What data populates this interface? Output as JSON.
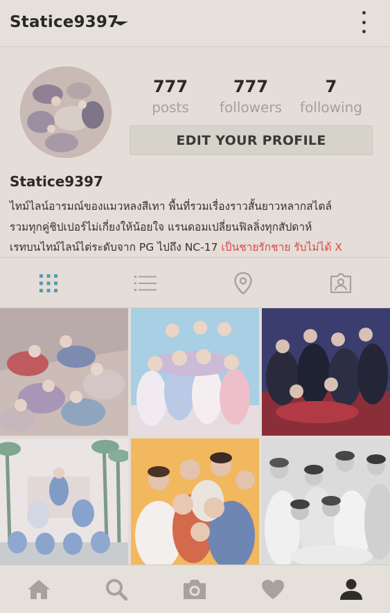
{
  "header": {
    "username": "Statice9397"
  },
  "profile": {
    "stats": [
      {
        "value": "777",
        "label": "posts"
      },
      {
        "value": "777",
        "label": "followers"
      },
      {
        "value": "7",
        "label": "following"
      }
    ],
    "edit_button": "EDIT YOUR PROFILE",
    "name": "Statice9397",
    "bio": {
      "line1": "ไทม์ไลน์อารมณ์ของแมวหลงสีเทา พื้นที่รวมเรื่องราวสั้นยาวหลากสไตล์",
      "line2": "รวมทุกคู่ชิปเปอร์ไม่เกี่ยงให้น้อยใจ แรนดอมเปลี่ยนฟิลลิ่งทุกสัปดาห์",
      "line3_main": "เรทบนไทม์ไลน์ไต่ระดับจาก PG ไปถึง NC-17 ",
      "line3_red": "เป็นชายรักชาย รับไม่ได้ X"
    }
  },
  "tabs": [
    {
      "icon": "grid-icon"
    },
    {
      "icon": "list-icon"
    },
    {
      "icon": "location-pin-icon"
    },
    {
      "icon": "tagged-person-icon"
    }
  ],
  "posts": [
    {
      "name": "post-1"
    },
    {
      "name": "post-2"
    },
    {
      "name": "post-3"
    },
    {
      "name": "post-4"
    },
    {
      "name": "post-5"
    },
    {
      "name": "post-6"
    }
  ],
  "bottom_nav": [
    {
      "icon": "home-icon"
    },
    {
      "icon": "search-icon"
    },
    {
      "icon": "camera-icon"
    },
    {
      "icon": "heart-icon"
    },
    {
      "icon": "profile-icon"
    }
  ],
  "colors": {
    "background": "#e4ddd8",
    "accent_red": "#e0463f",
    "active_tab": "#5a9ab0",
    "muted_icon": "#a8a19d"
  }
}
